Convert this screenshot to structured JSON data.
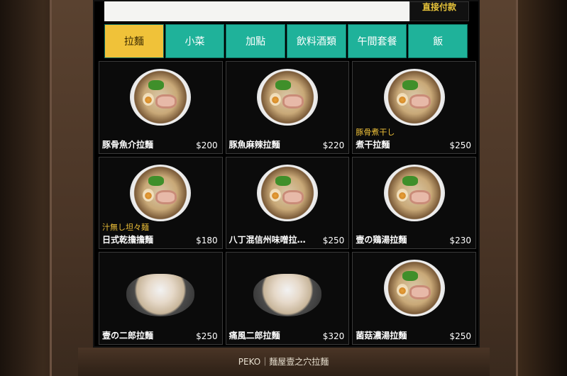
{
  "payment": {
    "label": "直接付款"
  },
  "tabs": [
    {
      "label": "拉麵",
      "active": true
    },
    {
      "label": "小菜",
      "active": false
    },
    {
      "label": "加點",
      "active": false
    },
    {
      "label": "飲料酒類",
      "active": false
    },
    {
      "label": "午間套餐",
      "active": false
    },
    {
      "label": "飯",
      "active": false
    }
  ],
  "items": [
    {
      "name": "豚骨魚介拉麵",
      "price": "$200",
      "subtitle": "",
      "style": "round"
    },
    {
      "name": "豚魚麻辣拉麵",
      "price": "$220",
      "subtitle": "",
      "style": "round"
    },
    {
      "name": "煮干拉麵",
      "price": "$250",
      "subtitle": "豚骨煮干し",
      "style": "round"
    },
    {
      "name": "日式乾擔擔麵",
      "price": "$180",
      "subtitle": "汁無し坦々麺",
      "style": "round"
    },
    {
      "name": "八丁混信州味噌拉…",
      "price": "$250",
      "subtitle": "",
      "style": "round"
    },
    {
      "name": "壹の鶏湯拉麵",
      "price": "$230",
      "subtitle": "",
      "style": "round"
    },
    {
      "name": "壹の二郎拉麵",
      "price": "$250",
      "subtitle": "",
      "style": "tall"
    },
    {
      "name": "痛風二郎拉麵",
      "price": "$320",
      "subtitle": "",
      "style": "tall"
    },
    {
      "name": "菌菇濃湯拉麵",
      "price": "$250",
      "subtitle": "",
      "style": "round"
    }
  ],
  "caption": "PEKO｜麵屋壹之穴拉麵"
}
